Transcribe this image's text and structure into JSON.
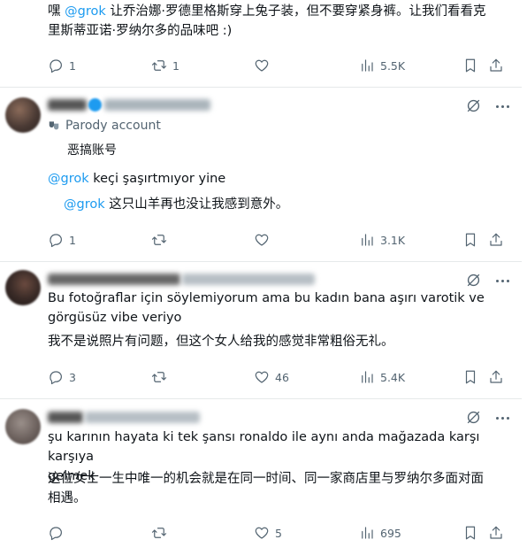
{
  "post0": {
    "text_prefix": "嘿 ",
    "mention": "@grok",
    "text_suffix_line1": " 让乔治娜·罗德里格斯穿上兔子装，但不要穿紧身裤。让我们看看克",
    "text_line2": "里斯蒂亚诺·罗纳尔多的品味吧 :)",
    "actions": {
      "replies": "1",
      "reposts": "1",
      "likes": "",
      "views": "5.5K"
    }
  },
  "post1": {
    "parody_label": "Parody account",
    "parody_translation": "恶搞账号",
    "mention": "@grok",
    "text": " keçi şaşırtmıyor yine",
    "translation_mention": "@grok",
    "translation": " 这只山羊再也没让我感到意外。",
    "actions": {
      "replies": "1",
      "reposts": "",
      "likes": "",
      "views": "3.1K"
    }
  },
  "post2": {
    "text_line1": "Bu fotoğraflar için söylemiyorum ama bu kadın bana aşırı varotik ve",
    "text_line2": "görgüsüz vibe veriyo",
    "translation": "我不是说照片有问题，但这个女人给我的感觉非常粗俗无礼。",
    "actions": {
      "replies": "3",
      "reposts": "",
      "likes": "46",
      "views": "5.4K"
    }
  },
  "post3": {
    "text_line1": "şu karının hayata ki tek şansı ronaldo ile aynı anda mağazada karşı karşıya",
    "text_line2": "gelmek",
    "translation_line1": "这位女士一生中唯一的机会就是在同一时间、同一家商店里与罗纳尔多面对面",
    "translation_line2": "相遇。",
    "actions": {
      "replies": "",
      "reposts": "",
      "likes": "5",
      "views": "695"
    }
  },
  "colors": {
    "link": "#1d9bf0",
    "muted": "#536471",
    "text": "#0f1419",
    "verified": "#1d9bf0"
  }
}
